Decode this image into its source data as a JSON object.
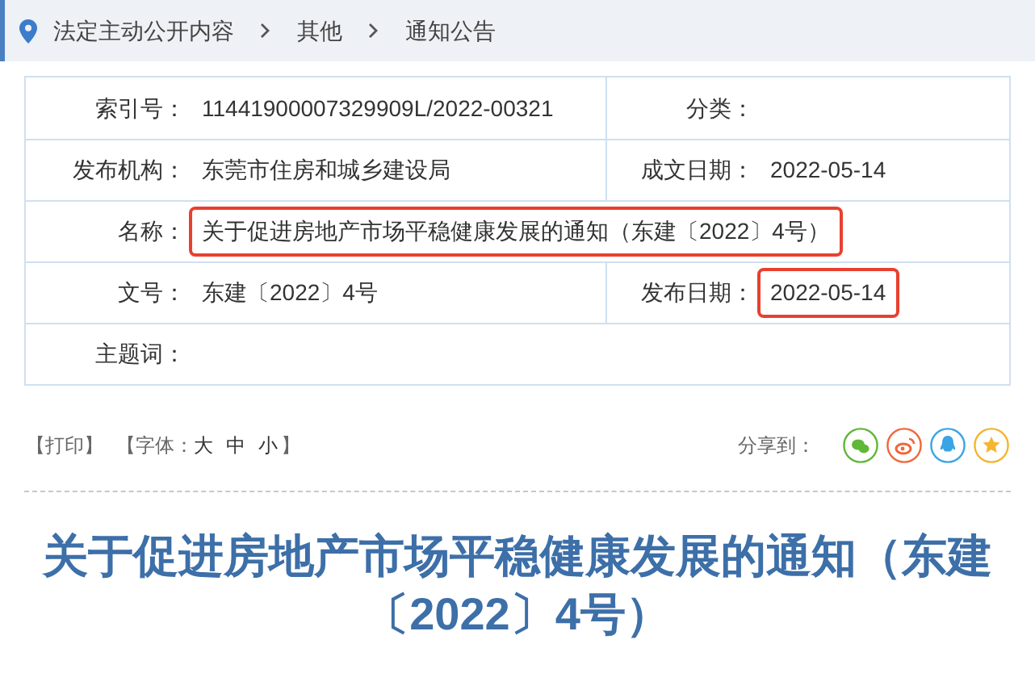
{
  "breadcrumb": [
    "法定主动公开内容",
    "其他",
    "通知公告"
  ],
  "meta": {
    "rows": [
      {
        "fields": [
          {
            "label": "索引号：",
            "value": "11441900007329909L/2022-00321"
          },
          {
            "label": "分类："
          }
        ]
      },
      {
        "fields": [
          {
            "label": "发布机构：",
            "value": "东莞市住房和城乡建设局"
          },
          {
            "label": "成文日期：",
            "value": "2022-05-14"
          }
        ]
      },
      {
        "fields": [
          {
            "label": "名称：",
            "value": "关于促进房地产市场平稳健康发展的通知（东建〔2022〕4号）",
            "highlighted": true
          }
        ]
      },
      {
        "fields": [
          {
            "label": "文号：",
            "value": "东建〔2022〕4号"
          },
          {
            "label": "发布日期：",
            "value": "2022-05-14",
            "highlighted": true
          }
        ]
      },
      {
        "fields": [
          {
            "label": "主题词："
          }
        ]
      }
    ]
  },
  "tools": {
    "print": "【打印】",
    "font_label": "【字体：",
    "font_sizes": [
      "大",
      "中",
      "小"
    ],
    "font_end": "】",
    "share_label": "分享到：",
    "share": [
      {
        "kind": "wechat",
        "color": "#5fb837"
      },
      {
        "kind": "weibo",
        "color": "#f0673b"
      },
      {
        "kind": "qq",
        "color": "#3ba4e6"
      },
      {
        "kind": "favorite",
        "color": "#f5b530"
      }
    ]
  },
  "title": "关于促进房地产市场平稳健康发展的通知（东建〔2022〕4号）"
}
